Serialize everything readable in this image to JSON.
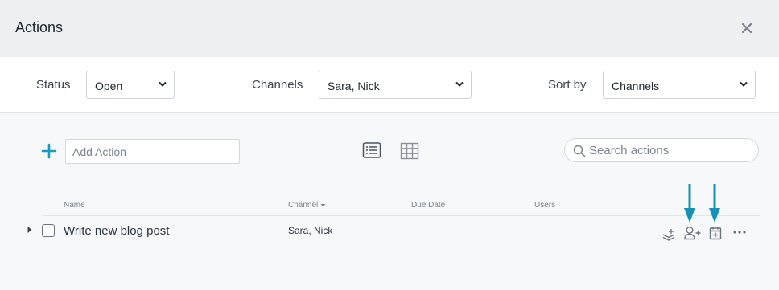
{
  "dialog": {
    "title": "Actions"
  },
  "filters": {
    "status": {
      "label": "Status",
      "value": "Open"
    },
    "channels": {
      "label": "Channels",
      "value": "Sara, Nick"
    },
    "sort": {
      "label": "Sort by",
      "value": "Channels"
    }
  },
  "toolbar": {
    "add_placeholder": "Add Action",
    "search_placeholder": "Search actions"
  },
  "table": {
    "columns": {
      "name": "Name",
      "channel": "Channel",
      "due_date": "Due Date",
      "users": "Users"
    },
    "rows": [
      {
        "name": "Write new blog post",
        "channel": "Sara, Nick",
        "due_date": "",
        "users": ""
      }
    ]
  },
  "colors": {
    "accent": "#1a9ac0",
    "arrow": "#1591b8",
    "icon": "#6b7280"
  },
  "icons": [
    "close-icon",
    "plus-icon",
    "list-view-icon",
    "grid-view-icon",
    "search-icon",
    "layers-icon",
    "add-user-icon",
    "calendar-add-icon",
    "more-icon"
  ]
}
